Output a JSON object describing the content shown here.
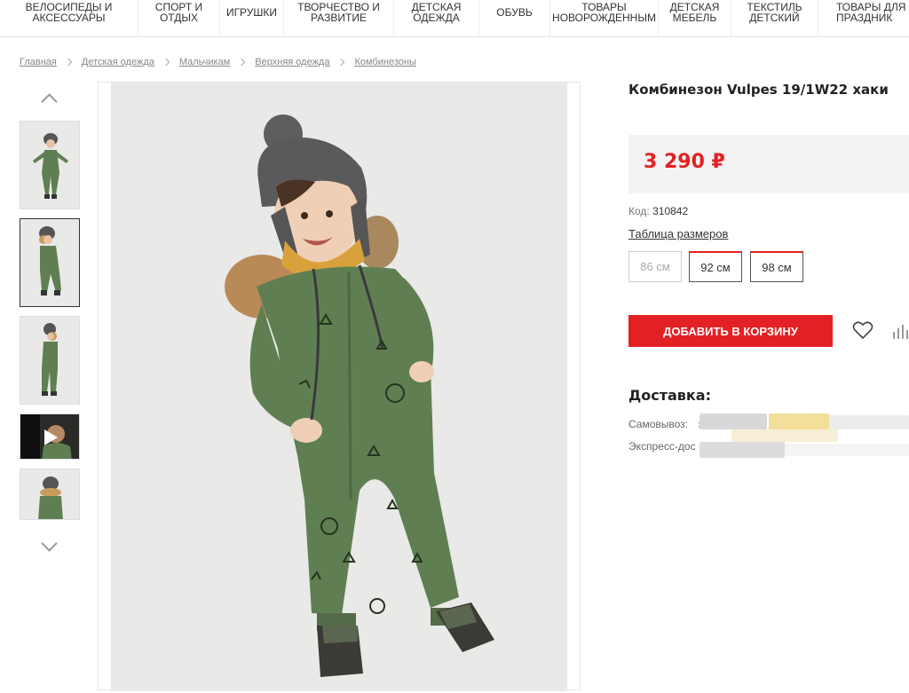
{
  "nav": [
    {
      "label": "ВЕЛОСИПЕДЫ И\nАКСЕССУАРЫ"
    },
    {
      "label": "СПОРТ И\nОТДЫХ"
    },
    {
      "label": "ИГРУШКИ"
    },
    {
      "label": "ТВОРЧЕСТВО И\nРАЗВИТИЕ"
    },
    {
      "label": "ДЕТСКАЯ\nОДЕЖДА"
    },
    {
      "label": "ОБУВЬ"
    },
    {
      "label": "ТОВАРЫ\nНОВОРОЖДЕННЫМ"
    },
    {
      "label": "ДЕТСКАЯ\nМЕБЕЛЬ"
    },
    {
      "label": "ТЕКСТИЛЬ\nДЕТСКИЙ"
    },
    {
      "label": "ТОВАРЫ ДЛЯ\nПРАЗДНИК"
    }
  ],
  "breadcrumb": [
    "Главная",
    "Детская одежда",
    "Мальчикам",
    "Верхняя одежда",
    "Комбинезоны"
  ],
  "product": {
    "title": "Комбинезон Vulpes 19/1W22 хаки",
    "price": "3 290 ₽",
    "code_label": "Код:",
    "code_value": "310842",
    "size_table_label": "Таблица размеров",
    "sizes": [
      {
        "label": "86 см",
        "available": false
      },
      {
        "label": "92 см",
        "available": true
      },
      {
        "label": "98 см",
        "available": true
      }
    ],
    "add_to_cart": "ДОБАВИТЬ В КОРЗИНУ"
  },
  "delivery": {
    "heading": "Доставка:",
    "pickup_label": "Самовывоз:",
    "pickup_tail": "з",
    "express_label": "Экспресс-дос"
  },
  "colors": {
    "accent": "#e32124",
    "suit": "#5f7f52",
    "hat": "#5a5a5a"
  }
}
